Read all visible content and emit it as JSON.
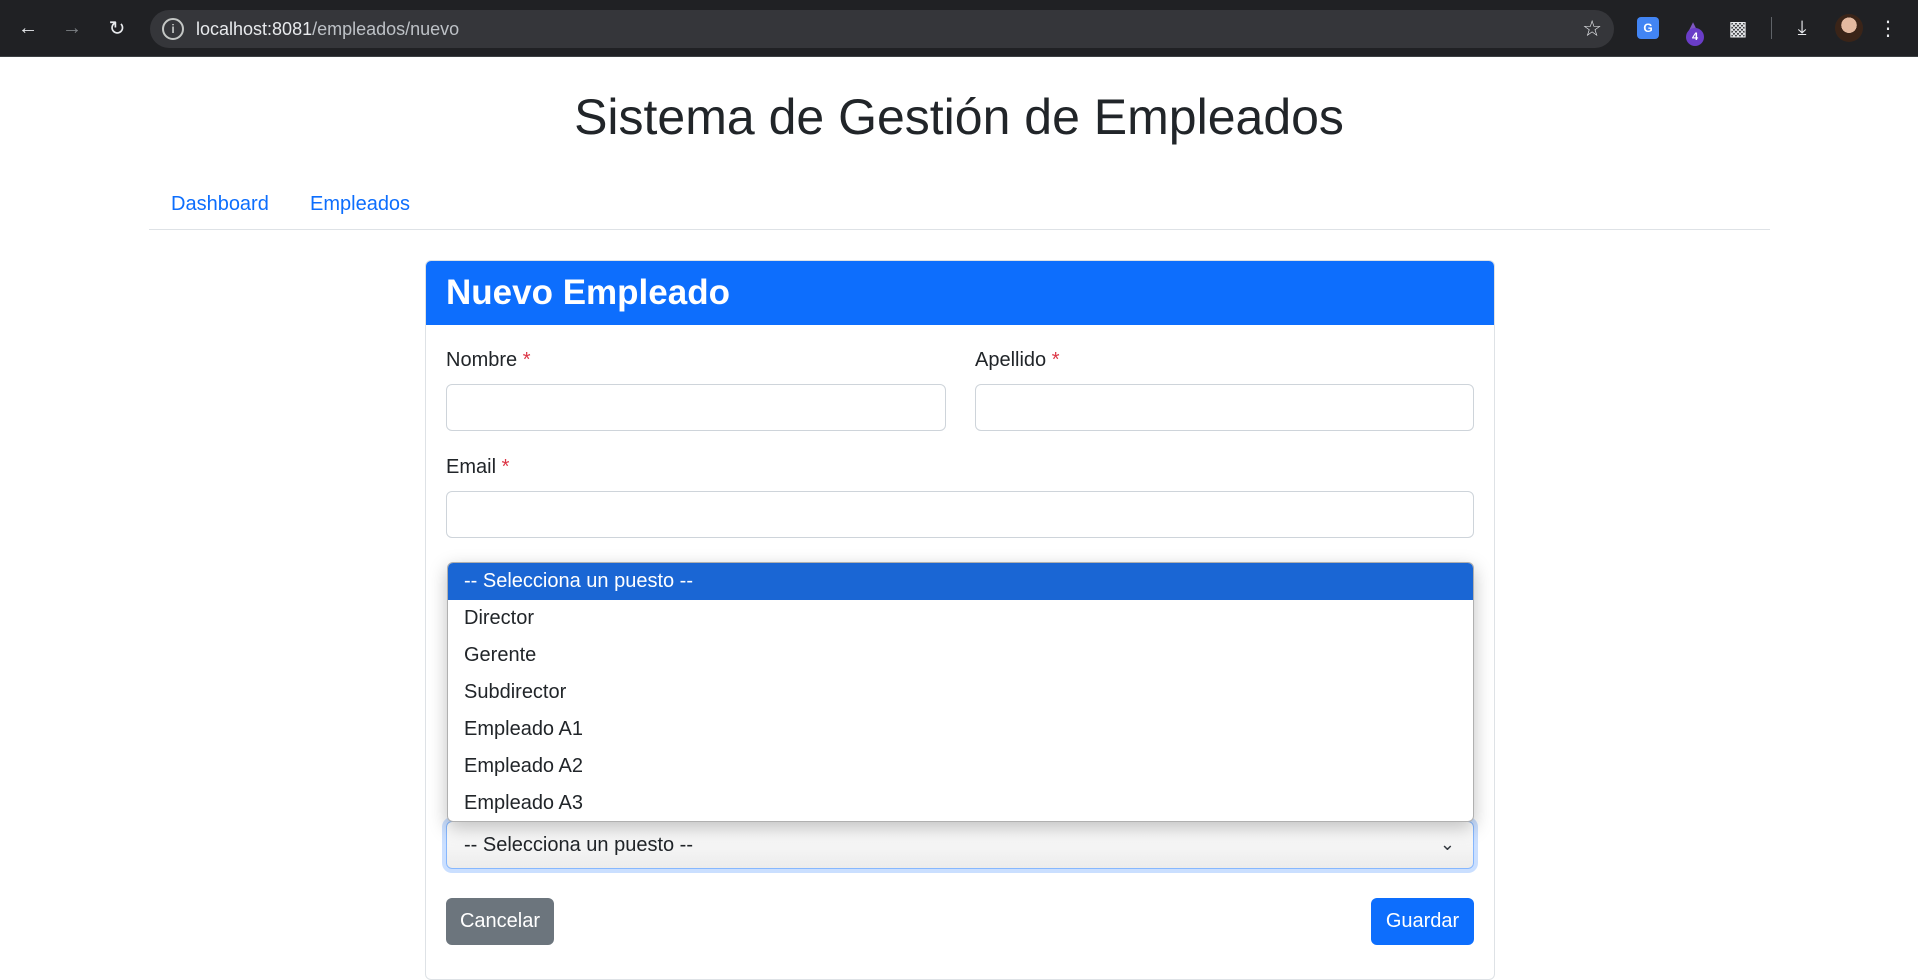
{
  "browser": {
    "url_host": "localhost:8081",
    "url_path": "/empleados/nuevo",
    "extension_badge": "4"
  },
  "page": {
    "title": "Sistema de Gestión de Empleados"
  },
  "nav": {
    "items": [
      {
        "label": "Dashboard"
      },
      {
        "label": "Empleados"
      }
    ]
  },
  "form": {
    "header": "Nuevo Empleado",
    "required_marker": "*",
    "fields": {
      "nombre": {
        "label": "Nombre",
        "value": ""
      },
      "apellido": {
        "label": "Apellido",
        "value": ""
      },
      "email": {
        "label": "Email",
        "value": ""
      }
    },
    "puesto": {
      "selected": "-- Selecciona un puesto --",
      "options": [
        "-- Selecciona un puesto --",
        "Director",
        "Gerente",
        "Subdirector",
        "Empleado A1",
        "Empleado A2",
        "Empleado A3"
      ]
    },
    "buttons": {
      "cancel": "Cancelar",
      "save": "Guardar"
    }
  },
  "colors": {
    "primary": "#0d6efd",
    "secondary": "#6c757d",
    "danger": "#dc3545",
    "selected_option": "#1a66d4"
  }
}
